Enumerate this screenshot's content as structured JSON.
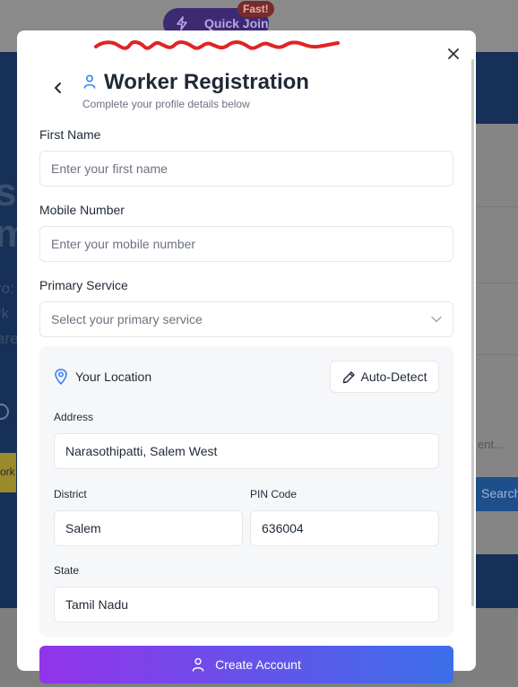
{
  "background": {
    "quick_join_label": "Quick Join",
    "fast_badge": "Fast!",
    "big_text_1": "st",
    "big_text_2": "m",
    "small_text_1": "ro:",
    "small_text_2": "rk",
    "small_text_3": "are",
    "yellow_btn_label": "ork",
    "side_placeholder": "ent...",
    "search_label": "Search"
  },
  "modal": {
    "title": "Worker Registration",
    "subtitle": "Complete your profile details below",
    "first_name": {
      "label": "First Name",
      "placeholder": "Enter your first name",
      "value": ""
    },
    "mobile": {
      "label": "Mobile Number",
      "placeholder": "Enter your mobile number",
      "value": ""
    },
    "service": {
      "label": "Primary Service",
      "placeholder": "Select your primary service"
    },
    "location": {
      "title": "Your Location",
      "auto_detect_label": "Auto-Detect",
      "address": {
        "label": "Address",
        "value": "Narasothipatti, Salem West"
      },
      "district": {
        "label": "District",
        "value": "Salem"
      },
      "pin": {
        "label": "PIN Code",
        "value": "636004"
      },
      "state": {
        "label": "State",
        "value": "Tamil Nadu"
      }
    },
    "create_account_label": "Create Account"
  },
  "colors": {
    "accent_start": "#9333ea",
    "accent_end": "#3b6fea",
    "icon_blue": "#3b82f6",
    "scribble": "#e02424"
  },
  "icons": [
    "close-icon",
    "chevron-left-icon",
    "user-icon",
    "chevron-down-icon",
    "map-pin-icon",
    "pencil-icon",
    "lightning-icon"
  ]
}
